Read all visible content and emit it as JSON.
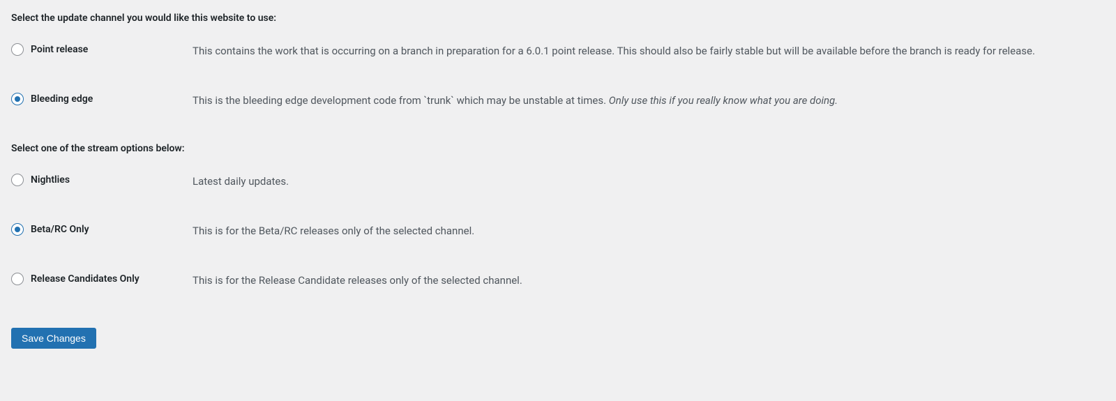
{
  "headings": {
    "channel": "Select the update channel you would like this website to use:",
    "stream": "Select one of the stream options below:"
  },
  "channel": {
    "point_release": {
      "label": "Point release",
      "description": "This contains the work that is occurring on a branch in preparation for a 6.0.1 point release. This should also be fairly stable but will be available before the branch is ready for release.",
      "selected": false
    },
    "bleeding_edge": {
      "label": "Bleeding edge",
      "desc_prefix": "This is the bleeding edge development code from `trunk` which may be unstable at times. ",
      "desc_italic": "Only use this if you really know what you are doing.",
      "selected": true
    }
  },
  "stream": {
    "nightlies": {
      "label": "Nightlies",
      "description": "Latest daily updates.",
      "selected": false
    },
    "beta_rc": {
      "label": "Beta/RC Only",
      "description": "This is for the Beta/RC releases only of the selected channel.",
      "selected": true
    },
    "rc_only": {
      "label": "Release Candidates Only",
      "description": "This is for the Release Candidate releases only of the selected channel.",
      "selected": false
    }
  },
  "buttons": {
    "save": "Save Changes"
  }
}
